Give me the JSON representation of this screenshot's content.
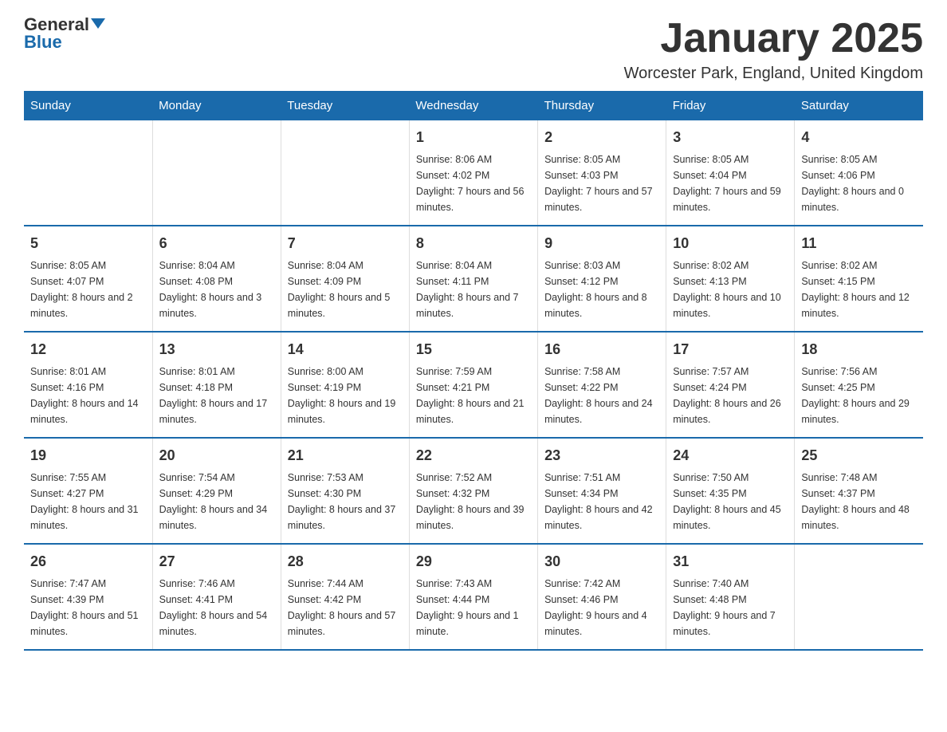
{
  "logo": {
    "general": "General",
    "blue": "Blue"
  },
  "header": {
    "title": "January 2025",
    "location": "Worcester Park, England, United Kingdom"
  },
  "days_of_week": [
    "Sunday",
    "Monday",
    "Tuesday",
    "Wednesday",
    "Thursday",
    "Friday",
    "Saturday"
  ],
  "weeks": [
    [
      {
        "day": "",
        "info": ""
      },
      {
        "day": "",
        "info": ""
      },
      {
        "day": "",
        "info": ""
      },
      {
        "day": "1",
        "info": "Sunrise: 8:06 AM\nSunset: 4:02 PM\nDaylight: 7 hours and 56 minutes."
      },
      {
        "day": "2",
        "info": "Sunrise: 8:05 AM\nSunset: 4:03 PM\nDaylight: 7 hours and 57 minutes."
      },
      {
        "day": "3",
        "info": "Sunrise: 8:05 AM\nSunset: 4:04 PM\nDaylight: 7 hours and 59 minutes."
      },
      {
        "day": "4",
        "info": "Sunrise: 8:05 AM\nSunset: 4:06 PM\nDaylight: 8 hours and 0 minutes."
      }
    ],
    [
      {
        "day": "5",
        "info": "Sunrise: 8:05 AM\nSunset: 4:07 PM\nDaylight: 8 hours and 2 minutes."
      },
      {
        "day": "6",
        "info": "Sunrise: 8:04 AM\nSunset: 4:08 PM\nDaylight: 8 hours and 3 minutes."
      },
      {
        "day": "7",
        "info": "Sunrise: 8:04 AM\nSunset: 4:09 PM\nDaylight: 8 hours and 5 minutes."
      },
      {
        "day": "8",
        "info": "Sunrise: 8:04 AM\nSunset: 4:11 PM\nDaylight: 8 hours and 7 minutes."
      },
      {
        "day": "9",
        "info": "Sunrise: 8:03 AM\nSunset: 4:12 PM\nDaylight: 8 hours and 8 minutes."
      },
      {
        "day": "10",
        "info": "Sunrise: 8:02 AM\nSunset: 4:13 PM\nDaylight: 8 hours and 10 minutes."
      },
      {
        "day": "11",
        "info": "Sunrise: 8:02 AM\nSunset: 4:15 PM\nDaylight: 8 hours and 12 minutes."
      }
    ],
    [
      {
        "day": "12",
        "info": "Sunrise: 8:01 AM\nSunset: 4:16 PM\nDaylight: 8 hours and 14 minutes."
      },
      {
        "day": "13",
        "info": "Sunrise: 8:01 AM\nSunset: 4:18 PM\nDaylight: 8 hours and 17 minutes."
      },
      {
        "day": "14",
        "info": "Sunrise: 8:00 AM\nSunset: 4:19 PM\nDaylight: 8 hours and 19 minutes."
      },
      {
        "day": "15",
        "info": "Sunrise: 7:59 AM\nSunset: 4:21 PM\nDaylight: 8 hours and 21 minutes."
      },
      {
        "day": "16",
        "info": "Sunrise: 7:58 AM\nSunset: 4:22 PM\nDaylight: 8 hours and 24 minutes."
      },
      {
        "day": "17",
        "info": "Sunrise: 7:57 AM\nSunset: 4:24 PM\nDaylight: 8 hours and 26 minutes."
      },
      {
        "day": "18",
        "info": "Sunrise: 7:56 AM\nSunset: 4:25 PM\nDaylight: 8 hours and 29 minutes."
      }
    ],
    [
      {
        "day": "19",
        "info": "Sunrise: 7:55 AM\nSunset: 4:27 PM\nDaylight: 8 hours and 31 minutes."
      },
      {
        "day": "20",
        "info": "Sunrise: 7:54 AM\nSunset: 4:29 PM\nDaylight: 8 hours and 34 minutes."
      },
      {
        "day": "21",
        "info": "Sunrise: 7:53 AM\nSunset: 4:30 PM\nDaylight: 8 hours and 37 minutes."
      },
      {
        "day": "22",
        "info": "Sunrise: 7:52 AM\nSunset: 4:32 PM\nDaylight: 8 hours and 39 minutes."
      },
      {
        "day": "23",
        "info": "Sunrise: 7:51 AM\nSunset: 4:34 PM\nDaylight: 8 hours and 42 minutes."
      },
      {
        "day": "24",
        "info": "Sunrise: 7:50 AM\nSunset: 4:35 PM\nDaylight: 8 hours and 45 minutes."
      },
      {
        "day": "25",
        "info": "Sunrise: 7:48 AM\nSunset: 4:37 PM\nDaylight: 8 hours and 48 minutes."
      }
    ],
    [
      {
        "day": "26",
        "info": "Sunrise: 7:47 AM\nSunset: 4:39 PM\nDaylight: 8 hours and 51 minutes."
      },
      {
        "day": "27",
        "info": "Sunrise: 7:46 AM\nSunset: 4:41 PM\nDaylight: 8 hours and 54 minutes."
      },
      {
        "day": "28",
        "info": "Sunrise: 7:44 AM\nSunset: 4:42 PM\nDaylight: 8 hours and 57 minutes."
      },
      {
        "day": "29",
        "info": "Sunrise: 7:43 AM\nSunset: 4:44 PM\nDaylight: 9 hours and 1 minute."
      },
      {
        "day": "30",
        "info": "Sunrise: 7:42 AM\nSunset: 4:46 PM\nDaylight: 9 hours and 4 minutes."
      },
      {
        "day": "31",
        "info": "Sunrise: 7:40 AM\nSunset: 4:48 PM\nDaylight: 9 hours and 7 minutes."
      },
      {
        "day": "",
        "info": ""
      }
    ]
  ]
}
